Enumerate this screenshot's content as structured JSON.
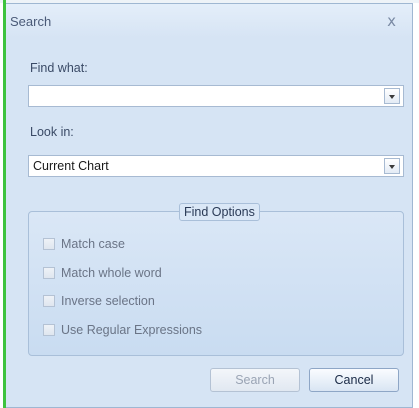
{
  "dialog": {
    "title": "Search",
    "close_glyph": "x"
  },
  "find_what": {
    "label": "Find what:",
    "value": ""
  },
  "look_in": {
    "label": "Look in:",
    "value": "Current Chart"
  },
  "find_options": {
    "title": "Find Options",
    "options": [
      {
        "label": "Match case",
        "checked": false
      },
      {
        "label": "Match whole word",
        "checked": false
      },
      {
        "label": "Inverse selection",
        "checked": false
      },
      {
        "label": "Use Regular Expressions",
        "checked": false
      }
    ]
  },
  "buttons": {
    "search_label": "Search",
    "search_enabled": false,
    "cancel_label": "Cancel"
  },
  "colors": {
    "window_bg": "#d6e4f4",
    "accent_green": "#3ec33e",
    "border": "#a7bad2"
  },
  "icons": {
    "close": "close-icon",
    "dropdown": "chevron-down-icon",
    "checkbox": "checkbox-icon"
  }
}
